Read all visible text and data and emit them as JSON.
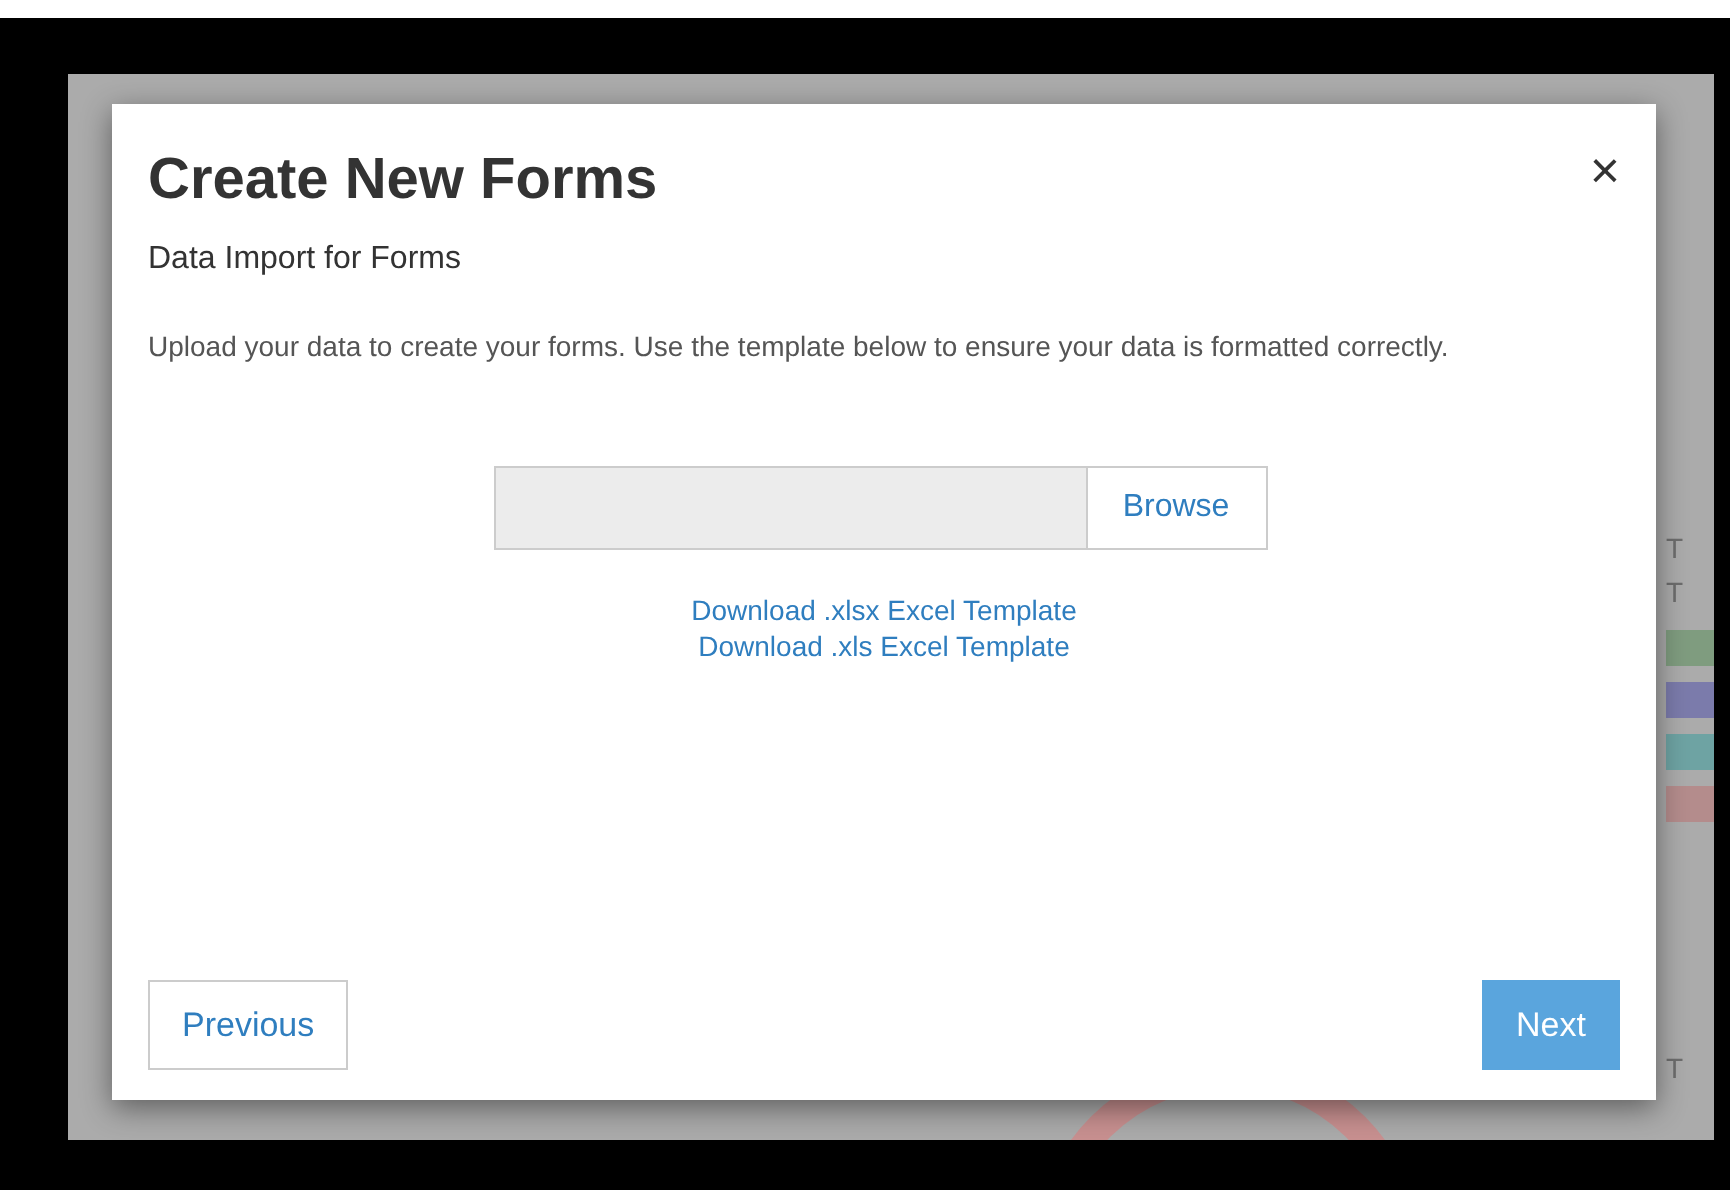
{
  "background": {
    "labels": [
      "T",
      "T",
      "T"
    ],
    "legend": [
      {
        "color": "#7f9c7f"
      },
      {
        "color": "#7b7bab"
      },
      {
        "color": "#6ea3a3"
      },
      {
        "color": "#b48c8c"
      }
    ]
  },
  "modal": {
    "title": "Create New Forms",
    "close": "×",
    "subtitle": "Data Import for Forms",
    "description": "Upload your data to create your forms. Use the template below to ensure your data is formatted correctly.",
    "file_field": {
      "browse": "Browse"
    },
    "links": [
      "Download .xlsx Excel Template",
      "Download .xls Excel Template"
    ],
    "buttons": [
      {
        "kind": "secondary",
        "label": "Previous"
      },
      {
        "kind": "primary",
        "label": "Next"
      }
    ]
  }
}
